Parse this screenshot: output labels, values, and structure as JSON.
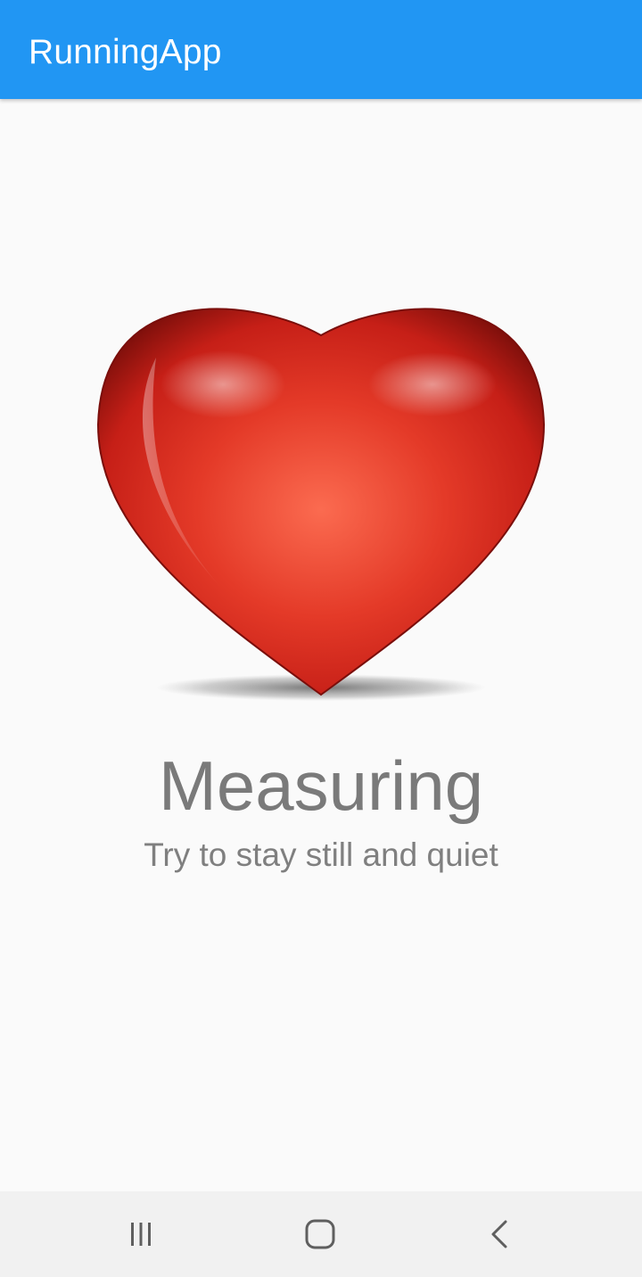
{
  "app_bar": {
    "title": "RunningApp",
    "color": "#2196f3"
  },
  "measurement": {
    "title": "Measuring",
    "subtitle": "Try to stay still and quiet",
    "image_icon": "heart-icon",
    "heart_color": "#d32a20"
  },
  "navigation_bar": {
    "buttons": [
      {
        "icon": "recents-icon"
      },
      {
        "icon": "home-icon"
      },
      {
        "icon": "back-icon"
      }
    ]
  }
}
